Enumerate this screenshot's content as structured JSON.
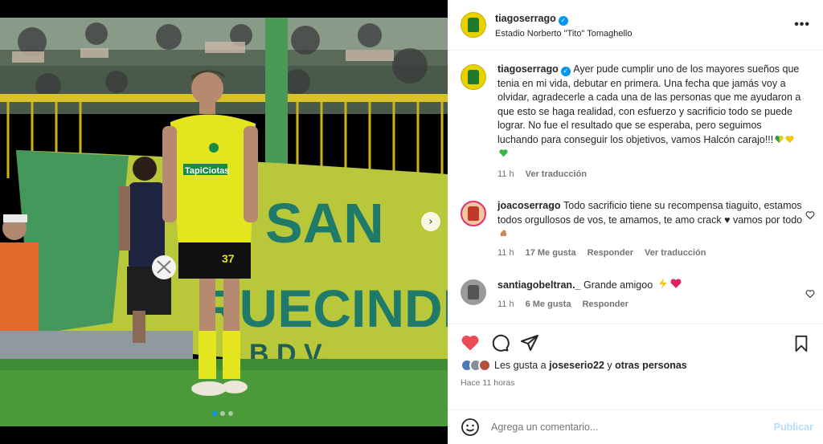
{
  "post": {
    "username": "tiagoserrago",
    "location": "Estadio Norberto \"Tito\" Tomaghello",
    "more_icon": "more-horizontal-icon"
  },
  "media": {
    "slide_count": 3,
    "active_slide": 1,
    "banner_text_1": "SAN",
    "banner_text_2": "RUECINDI",
    "banner_text_3": "B.D.V.",
    "shirt_sponsor": "TapiCiotas",
    "shirt_number": "37"
  },
  "caption": {
    "username": "tiagoserrago",
    "text": "Ayer pude cumplir uno de los mayores sueños que tenia en mi vida, debutar en primera. Una fecha que jamás voy a olvidar, agradecerle a cada una de las personas que me ayudaron a que esto se haga realidad, con esfuerzo y sacrificio todo se puede lograr. No fue el resultado que se esperaba, pero seguimos luchando para conseguir los objetivos, vamos Halcón carajo!!!",
    "time": "11 h",
    "translate": "Ver traducción"
  },
  "comments": [
    {
      "username": "joacoserrago",
      "text": "Todo sacrificio tiene su recompensa tiaguito, estamos todos orgullosos de vos, te amamos, te amo crack ♥ vamos por todo",
      "time": "11 h",
      "likes": "17 Me gusta",
      "reply": "Responder",
      "translate": "Ver traducción"
    },
    {
      "username": "santiagobeltran._",
      "text": "Grande amigoo",
      "time": "11 h",
      "likes": "6 Me gusta",
      "reply": "Responder"
    }
  ],
  "likes": {
    "prefix": "Les gusta a",
    "user": "joseserio22",
    "joiner": "y",
    "others": "otras personas"
  },
  "posted_ago": "Hace 11 horas",
  "composer": {
    "placeholder": "Agrega un comentario...",
    "publish": "Publicar"
  },
  "colors": {
    "accent": "#0095f6",
    "like_red": "#ed4956",
    "muted": "#737373",
    "publish_disabled": "#b2dffc"
  }
}
